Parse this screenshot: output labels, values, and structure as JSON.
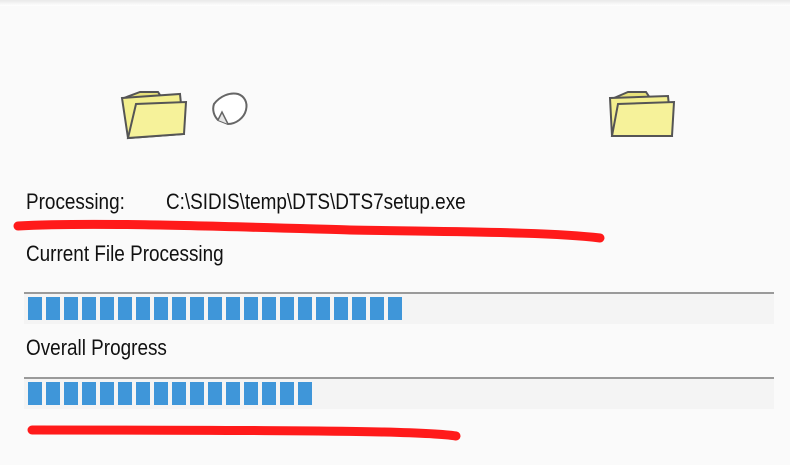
{
  "processing": {
    "label": "Processing:",
    "path": "C:\\SIDIS\\temp\\DTS\\DTS7setup.exe"
  },
  "current_file": {
    "label": "Current File Processing",
    "progress": 0.49
  },
  "overall": {
    "label": "Overall Progress",
    "progress": 0.37
  },
  "icons": {
    "source": "folder-icon",
    "moving": "document-icon",
    "destination": "folder-icon"
  },
  "colors": {
    "progress_fill": "#3f96d9",
    "annotation": "#ff1a1a",
    "folder": "#f3ef8e"
  }
}
